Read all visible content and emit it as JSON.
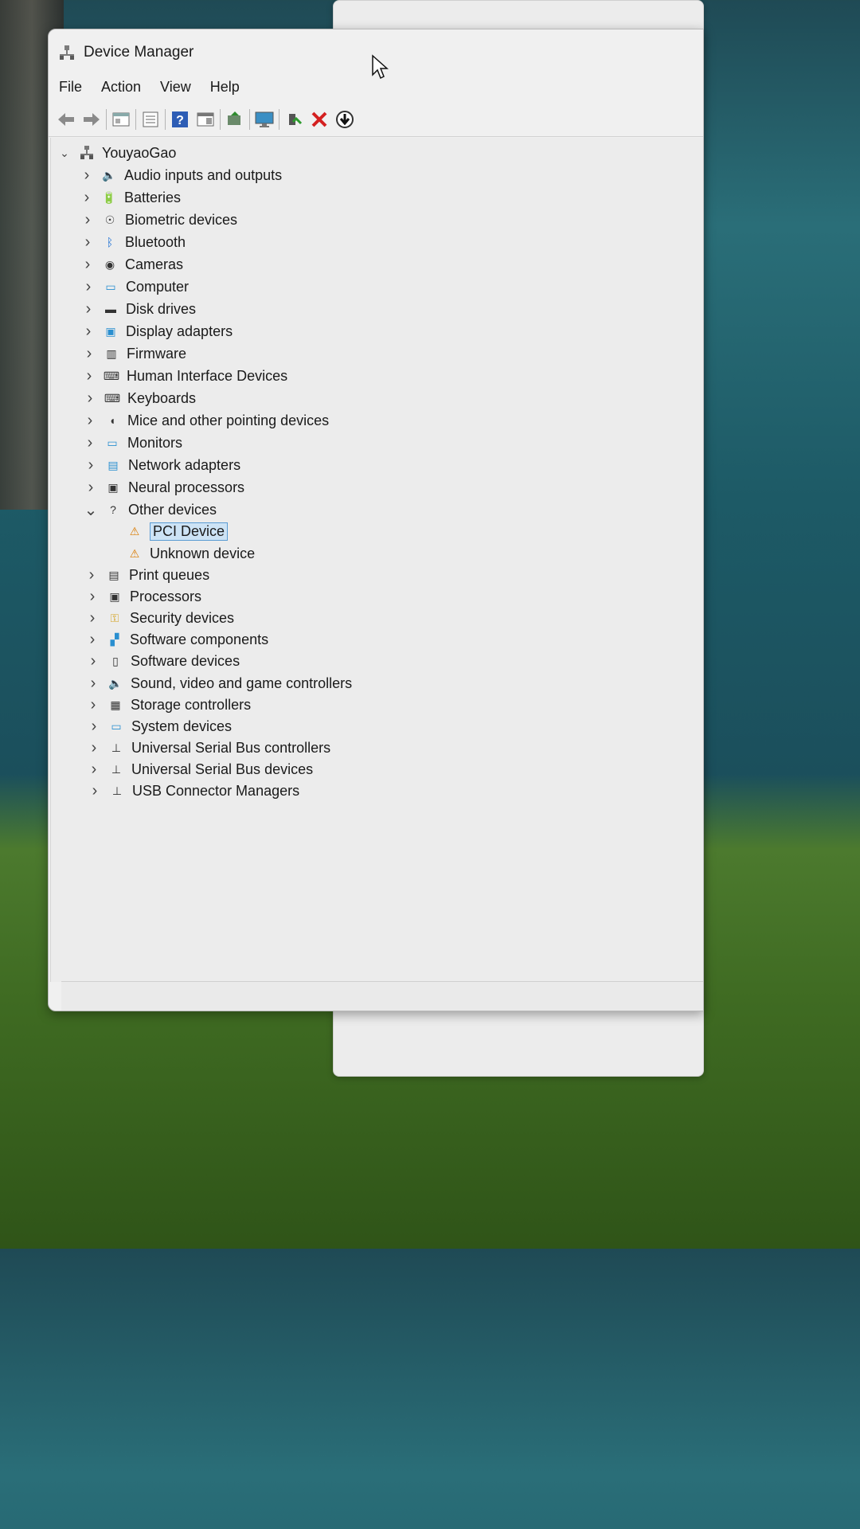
{
  "window": {
    "title": "Device Manager"
  },
  "menu": [
    "File",
    "Action",
    "View",
    "Help"
  ],
  "toolbar_icons": [
    "back-icon",
    "forward-icon",
    "properties-icon",
    "list-icon",
    "help-icon",
    "view-icon",
    "update-driver-icon",
    "monitor-icon",
    "enable-device-icon",
    "uninstall-icon",
    "scan-hardware-icon"
  ],
  "tree": {
    "root": "YouyaoGao",
    "items": [
      {
        "label": "Audio inputs and outputs",
        "icon": "speaker-icon"
      },
      {
        "label": "Batteries",
        "icon": "battery-icon"
      },
      {
        "label": "Biometric devices",
        "icon": "fingerprint-icon"
      },
      {
        "label": "Bluetooth",
        "icon": "bluetooth-icon"
      },
      {
        "label": "Cameras",
        "icon": "camera-icon"
      },
      {
        "label": "Computer",
        "icon": "computer-icon"
      },
      {
        "label": "Disk drives",
        "icon": "disk-icon"
      },
      {
        "label": "Display adapters",
        "icon": "display-adapter-icon"
      },
      {
        "label": "Firmware",
        "icon": "firmware-icon"
      },
      {
        "label": "Human Interface Devices",
        "icon": "hid-icon"
      },
      {
        "label": "Keyboards",
        "icon": "keyboard-icon"
      },
      {
        "label": "Mice and other pointing devices",
        "icon": "mouse-icon"
      },
      {
        "label": "Monitors",
        "icon": "monitor-icon"
      },
      {
        "label": "Network adapters",
        "icon": "network-icon"
      },
      {
        "label": "Neural processors",
        "icon": "chip-icon"
      },
      {
        "label": "Other devices",
        "icon": "unknown-device-icon",
        "expanded": true
      },
      {
        "label": "PCI Device",
        "icon": "warning-device-icon",
        "child": true,
        "selected": true
      },
      {
        "label": "Unknown device",
        "icon": "warning-device-icon",
        "child": true
      },
      {
        "label": "Print queues",
        "icon": "printer-icon"
      },
      {
        "label": "Processors",
        "icon": "chip-icon"
      },
      {
        "label": "Security devices",
        "icon": "security-key-icon"
      },
      {
        "label": "Software components",
        "icon": "software-component-icon"
      },
      {
        "label": "Software devices",
        "icon": "software-device-icon"
      },
      {
        "label": "Sound, video and game controllers",
        "icon": "speaker-icon"
      },
      {
        "label": "Storage controllers",
        "icon": "storage-icon"
      },
      {
        "label": "System devices",
        "icon": "system-icon"
      },
      {
        "label": "Universal Serial Bus controllers",
        "icon": "usb-icon"
      },
      {
        "label": "Universal Serial Bus devices",
        "icon": "usb-icon"
      },
      {
        "label": "USB Connector Managers",
        "icon": "usb-icon"
      }
    ]
  }
}
